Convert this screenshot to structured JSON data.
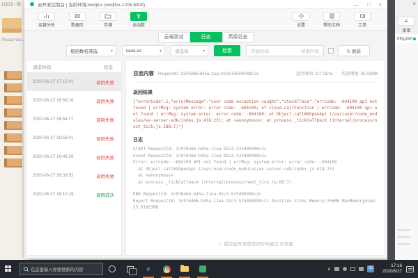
{
  "glyphs": {
    "caret": "▾",
    "minimize": "—",
    "maximize": "□",
    "close": "×",
    "menu": "≡",
    "refresh_label": "↻ 刷新",
    "feedback": "☺",
    "tray_expand": "∧",
    "ime": "中",
    "date_sep": "-"
  },
  "background_window": {
    "title": "12222 - 后",
    "loading": "Please Wa.."
  },
  "window": {
    "title": "云开发控制台 | 当前环境:wxdjfcx (wxdjfcx-1206-64f4f)"
  },
  "toolbar": {
    "nav": [
      {
        "label": "运营分析"
      },
      {
        "label": "数据库"
      },
      {
        "label": "存储"
      },
      {
        "label": "云函数"
      }
    ],
    "actions": [
      {
        "label": "设置"
      },
      {
        "label": "帮助文档"
      },
      {
        "label": "工单"
      }
    ]
  },
  "tabs": [
    {
      "label": "云端测试"
    },
    {
      "label": "日志"
    },
    {
      "label": "高级日志"
    }
  ],
  "filters": {
    "name_filter": "按函数名筛选",
    "function_name": "taskList",
    "status_filter": "请选择",
    "search_button": "检索",
    "date_start": "开始时间",
    "date_end": "结束时间"
  },
  "log_list": {
    "headers": [
      "请求时间",
      "状态"
    ],
    "rows": [
      {
        "time": "2020-06-27 17:15:41",
        "status": "调用失败"
      },
      {
        "time": "2020-06-27 16:56:16",
        "status": "调用失败"
      },
      {
        "time": "2020-06-27 16:54:27",
        "status": "调用失败"
      },
      {
        "time": "2020-06-27 16:53:41",
        "status": "调用失败"
      },
      {
        "time": "2020-06-27 16:49:26",
        "status": "调用失败"
      },
      {
        "time": "2020-06-27 16:33:52",
        "status": "调用失败"
      },
      {
        "time": "2020-06-27 16:10:19",
        "status": "调用成功"
      }
    ]
  },
  "detail": {
    "title": "日志内容",
    "request_id": "RequestID: 2c976466-b45a-11ea-92c3-525400998c2c",
    "runtime": "运行时间: 117.21ms",
    "memory": "内存使用: 35.02MB",
    "result_title": "返回结果",
    "result_body": "{\"errorCode\":1,\"errorMessage\":\"user code exception caught\",\"stackTrace\":\"errCode: -604100 api not found | errMsg: system error: error code: -604100; at cloud.callFunction | errCode: -604100 api not found | errMsg: system error: error code: -604100; at Object.callWXOpenApi (/var/user/node_modules/wx-server-sdk/index.js:418:23); at <anonymous>; at process._tickCallback (internal/process/next_tick.js:188:7)\"}",
    "log_title": "日志",
    "log_lines": [
      "START RequestId: 2c976466-b45a-11ea-92c3-525400998c2c",
      "Event RequestId: 2c976466-b45a-11ea-92c3-525400998c2c",
      "Error: errCode: -604100 API not found | errMsg: system error: error code: -604100",
      "  at Object.callWXOpenApi (/var/user/node_modules/wx-server-sdk/index.js:418:23)",
      "  at <anonymous>",
      "  at process._tickCallback (internal/process/next_tick.js:68:7)",
      "",
      "END RequestId: 2c976466-b45a-11ea-92c3-525400998c2c",
      "Report RequestId: 2c976466-b45a-11ea-92c3-525400998c2c Duration:117ms Memory:256MB MaxMemoryUsed:35.01953MB"
    ],
    "footer": "提交云开发使用评价与建议,有惊喜"
  },
  "editor": {
    "menu_label": "菜单",
    "tab_name": "nfig.json"
  },
  "taskbar": {
    "search_placeholder": "在这里输入你要搜索的内容",
    "time": "17:16",
    "date": "2020/6/27"
  },
  "colors": {
    "accent": "#07c160",
    "fail": "#de5246",
    "success": "#2ea35f",
    "error_text": "#b2604e"
  }
}
